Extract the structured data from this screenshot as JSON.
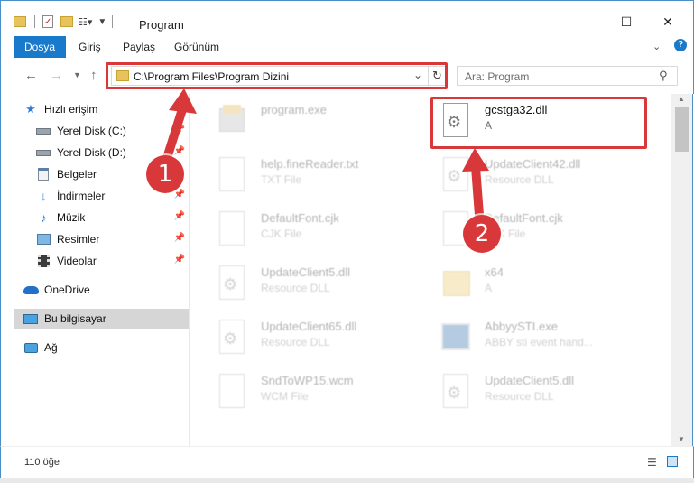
{
  "window": {
    "title": "Program"
  },
  "ribbon": {
    "tabs": [
      "Dosya",
      "Giriş",
      "Paylaş",
      "Görünüm"
    ]
  },
  "address": {
    "path": "C:\\Program Files\\Program Dizini"
  },
  "search": {
    "placeholder": "Ara: Program"
  },
  "sidebar": {
    "items": [
      {
        "label": "Hızlı erişim",
        "icon": "star-icon"
      },
      {
        "label": "Yerel Disk (C:)",
        "icon": "drive-icon"
      },
      {
        "label": "Yerel Disk (D:)",
        "icon": "drive-icon"
      },
      {
        "label": "Belgeler",
        "icon": "documents-icon"
      },
      {
        "label": "İndirmeler",
        "icon": "download-icon"
      },
      {
        "label": "Müzik",
        "icon": "music-icon"
      },
      {
        "label": "Resimler",
        "icon": "pictures-icon"
      },
      {
        "label": "Videolar",
        "icon": "video-icon"
      },
      {
        "label": "OneDrive",
        "icon": "cloud-icon"
      },
      {
        "label": "Bu bilgisayar",
        "icon": "computer-icon"
      },
      {
        "label": "Ağ",
        "icon": "network-icon"
      }
    ]
  },
  "files": [
    {
      "name": "program.exe",
      "desc": "",
      "icon": "exe-icon"
    },
    {
      "name": "gcstga32.dll",
      "desc": "A",
      "icon": "dll-icon"
    },
    {
      "name": "help.fineReader.txt",
      "desc": "TXT File",
      "icon": "doc-icon"
    },
    {
      "name": "UpdateClient42.dll",
      "desc": "Resource DLL",
      "icon": "dll-icon"
    },
    {
      "name": "DefaultFont.cjk",
      "desc": "CJK File",
      "icon": "doc-icon"
    },
    {
      "name": "DefaultFont.cjk",
      "desc": "CJK File",
      "icon": "doc-icon"
    },
    {
      "name": "UpdateClient5.dll",
      "desc": "Resource DLL",
      "icon": "dll-icon"
    },
    {
      "name": "x64",
      "desc": "A",
      "icon": "folder-icon"
    },
    {
      "name": "UpdateClient65.dll",
      "desc": "Resource DLL",
      "icon": "dll-icon"
    },
    {
      "name": "AbbyySTI.exe",
      "desc": "ABBY sti event hand...",
      "icon": "exe-icon"
    },
    {
      "name": "SndToWP15.wcm",
      "desc": "WCM File",
      "icon": "doc-icon"
    },
    {
      "name": "UpdateClient5.dll",
      "desc": "Resource DLL",
      "icon": "dll-icon"
    }
  ],
  "status": {
    "count": "110 öğe"
  },
  "annotations": {
    "badge1": "1",
    "badge2": "2",
    "color": "#d9383a"
  }
}
